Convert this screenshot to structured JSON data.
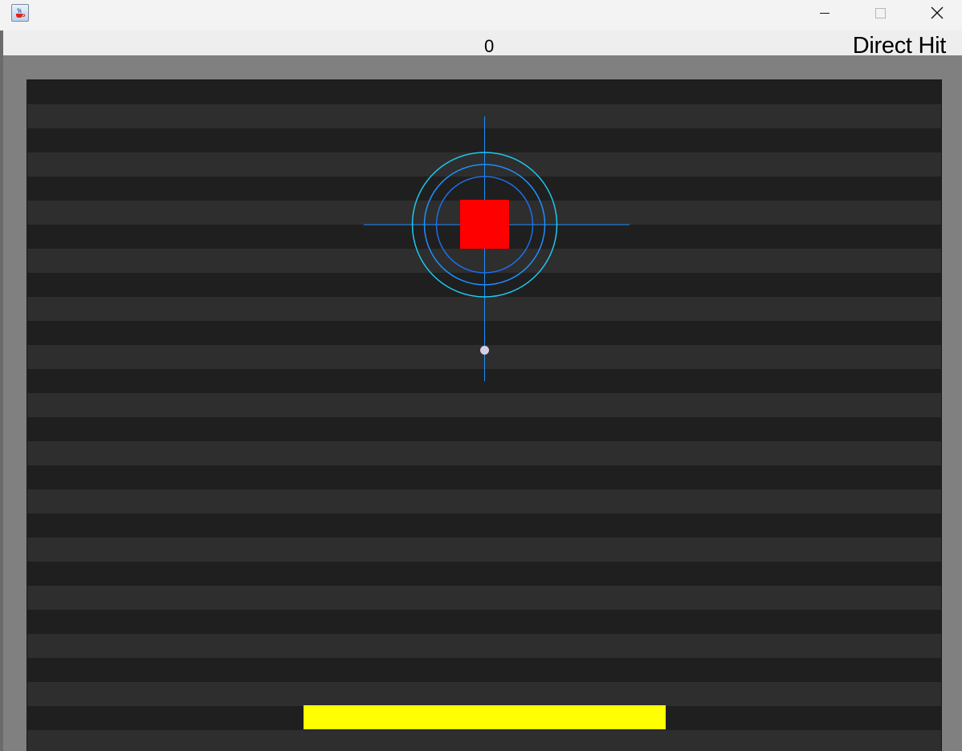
{
  "window": {
    "app_icon": "java-coffee-cup-icon",
    "controls": {
      "minimize": "minimize-icon",
      "maximize": "maximize-icon",
      "close": "close-icon"
    }
  },
  "hud": {
    "score": "0",
    "status": "Direct Hit"
  },
  "game": {
    "colors": {
      "panel_background": "#808080",
      "stripe_dark": "#1f1f1f",
      "stripe_light": "#2e2e2e",
      "target": "#ff0000",
      "reticle_ring_outer": "#1fc8ee",
      "reticle_ring_middle": "#1e90ff",
      "reticle_ring_inner": "#1e6ee6",
      "crosshair": "#1e90ff",
      "ball": "#d4cfe6",
      "paddle": "#ffff00"
    }
  }
}
